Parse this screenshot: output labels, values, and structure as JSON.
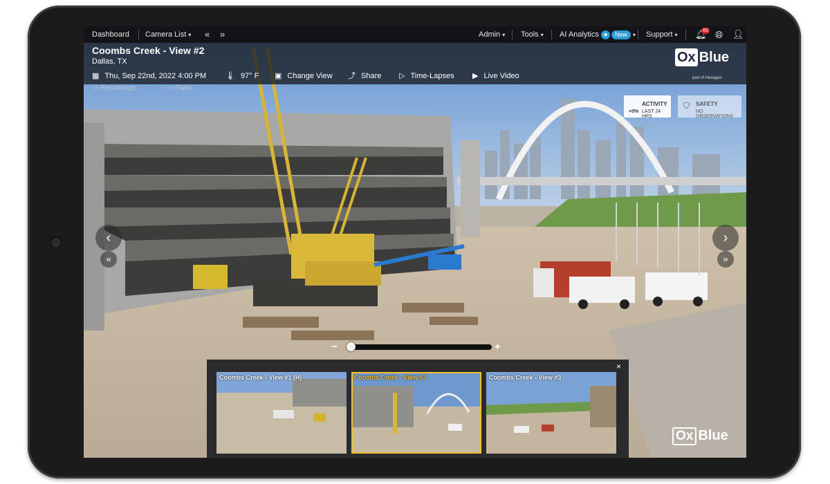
{
  "nav": {
    "dashboard": "Dashboard",
    "camera_list": "Camera List",
    "prev": "«",
    "next": "»",
    "admin": "Admin",
    "tools": "Tools",
    "ai_analytics": "AI Analytics",
    "new_badge": "New",
    "support": "Support",
    "notification_count": "60"
  },
  "header": {
    "title": "Coombs Creek - View #2",
    "location": "Dallas, TX",
    "datetime": "Thu, Sep 22nd, 2022 4:00 PM",
    "temperature": "97° F",
    "change_view": "Change View",
    "share": "Share",
    "time_lapses": "Time-Lapses",
    "live_video": "Live Video",
    "recordings": "Recordings",
    "pano": "Pano"
  },
  "brand": {
    "ox": "Ox",
    "blue": "Blue",
    "part_of": "part of Hexagon"
  },
  "activity": {
    "label": "ACTIVITY",
    "change": "+0%",
    "period": "LAST 24 HRS"
  },
  "safety": {
    "label": "SAFETY",
    "status": "NO OBSERVATIONS"
  },
  "zoom": {
    "minus": "−",
    "plus": "+",
    "level": 0
  },
  "thumbnails": [
    {
      "label": "Coombs Creek - View #1 (H)",
      "active": false
    },
    {
      "label": "Coombs Creek - View #2",
      "active": true
    },
    {
      "label": "Coombs Creek - View #3",
      "active": false
    }
  ],
  "thumbnail_close": "×",
  "colors": {
    "accent": "#2e9bd6",
    "active_thumb_label": "#f2c12e",
    "badge_red": "#d52020"
  }
}
